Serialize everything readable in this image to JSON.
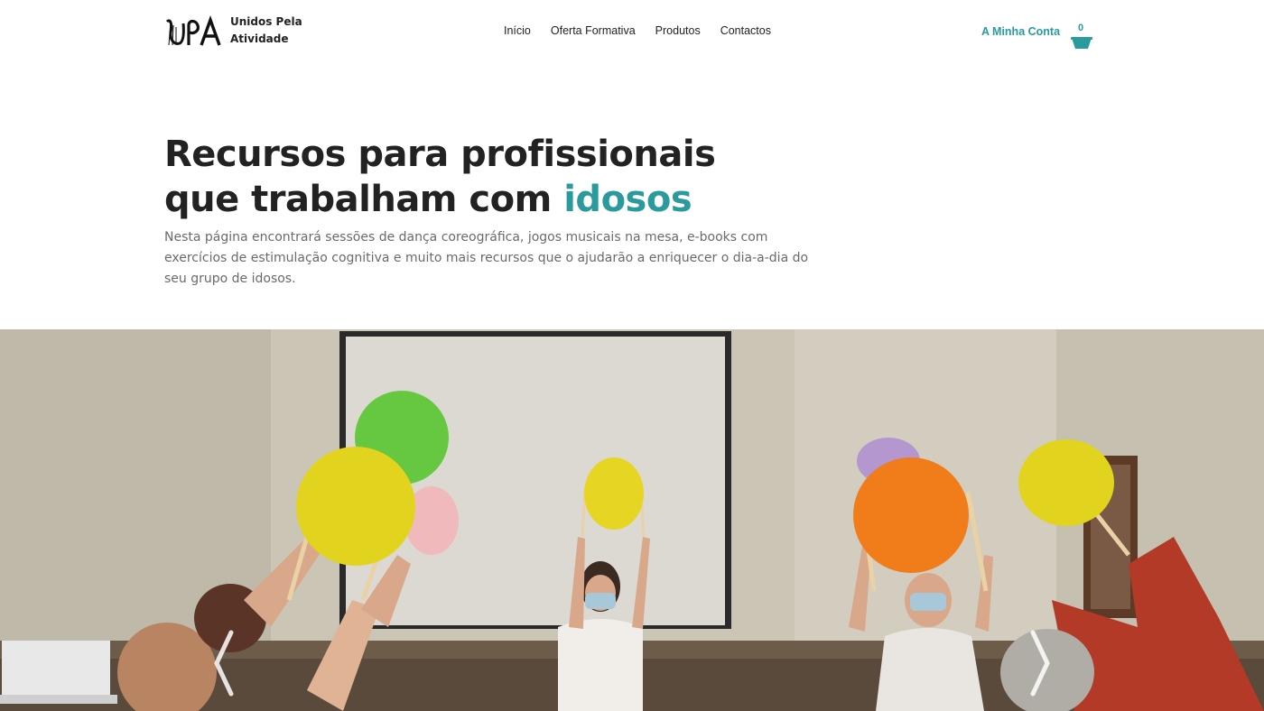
{
  "brand": {
    "line1": "Unidos Pela",
    "line2": "Atividade",
    "logo_text": "UPA",
    "logo_icon": "upa-logo-mark"
  },
  "nav": {
    "items": [
      {
        "label": "Início"
      },
      {
        "label": "Oferta Formativa"
      },
      {
        "label": "Produtos"
      },
      {
        "label": "Contactos"
      }
    ]
  },
  "account": {
    "label": "A Minha Conta",
    "cart_count": "0",
    "cart_icon": "basket-icon"
  },
  "hero": {
    "title_line1": "Recursos para profissionais",
    "title_line2_prefix": "que trabalham com ",
    "title_line2_accent": "idosos",
    "description": "Nesta página encontrará sessões de dança coreográfica, jogos musicais na mesa, e-books com exercícios de estimulação cognitiva e muito mais recursos que o ajudarão a enriquecer o dia-a-dia do seu grupo de idosos."
  },
  "carousel": {
    "prev_icon": "chevron-left-icon",
    "next_icon": "chevron-right-icon"
  },
  "colors": {
    "accent": "#2a9a9d",
    "text": "#222222",
    "muted": "#6a6a6a"
  }
}
